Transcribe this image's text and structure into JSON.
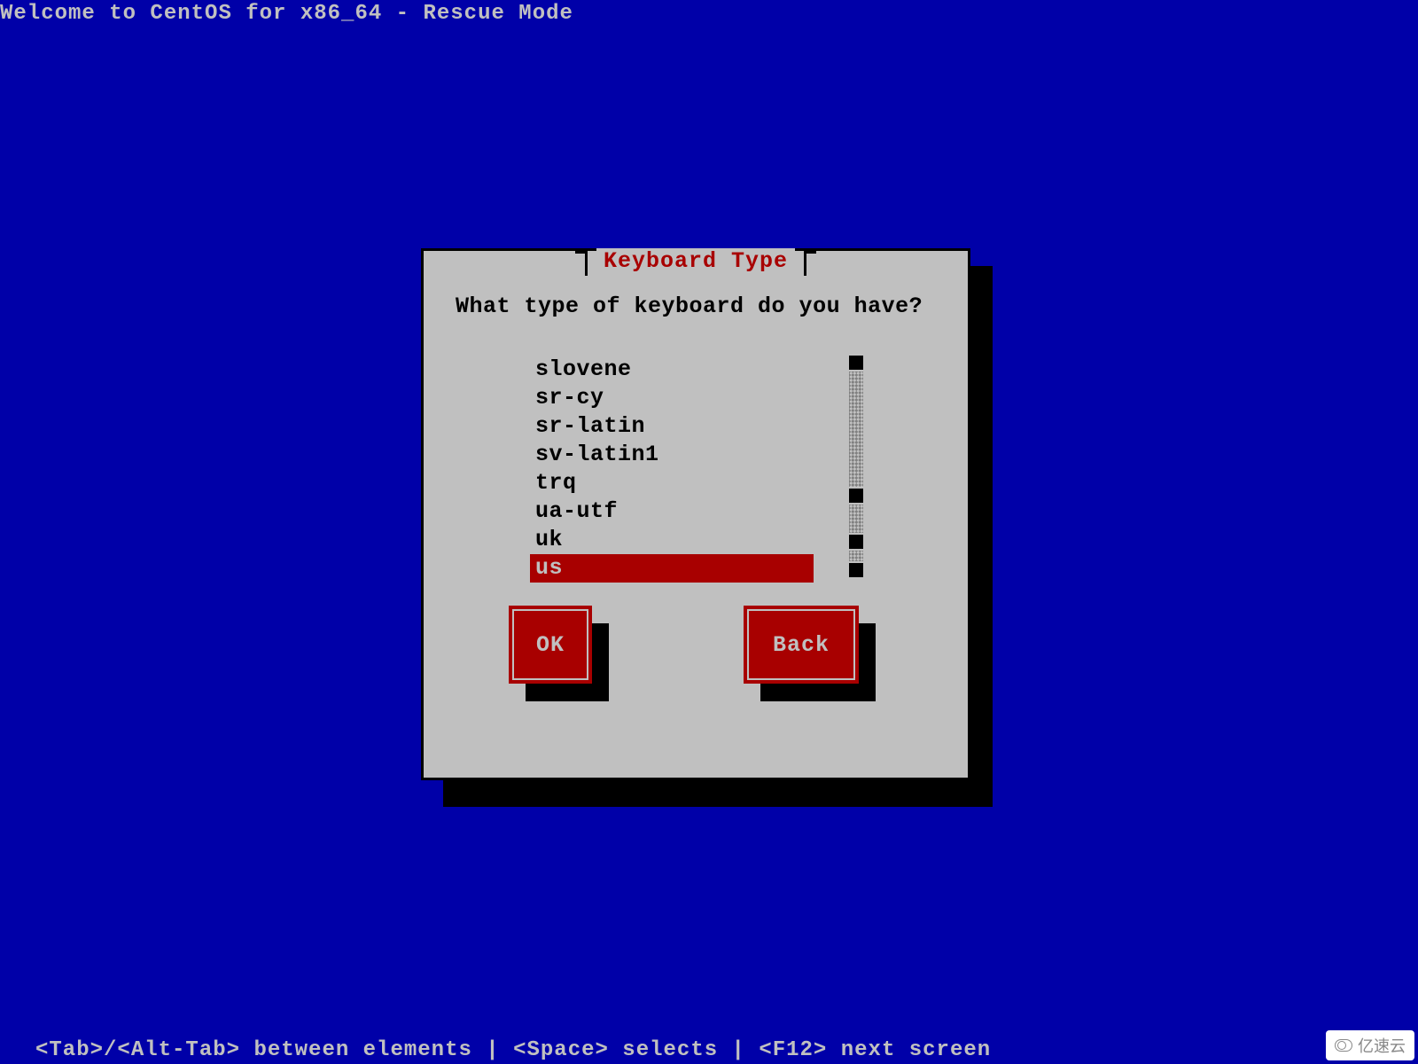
{
  "header": {
    "title": "Welcome to CentOS for x86_64 - Rescue Mode"
  },
  "dialog": {
    "title": "Keyboard Type",
    "prompt": "What type of keyboard do you have?",
    "items": [
      "slovene",
      "sr-cy",
      "sr-latin",
      "sv-latin1",
      "trq",
      "ua-utf",
      "uk",
      "us"
    ],
    "selected_index": 7,
    "buttons": {
      "ok": "OK",
      "back": "Back"
    }
  },
  "footer": {
    "help": "<Tab>/<Alt-Tab> between elements  | <Space> selects | <F12> next screen"
  },
  "watermark": "亿速云"
}
